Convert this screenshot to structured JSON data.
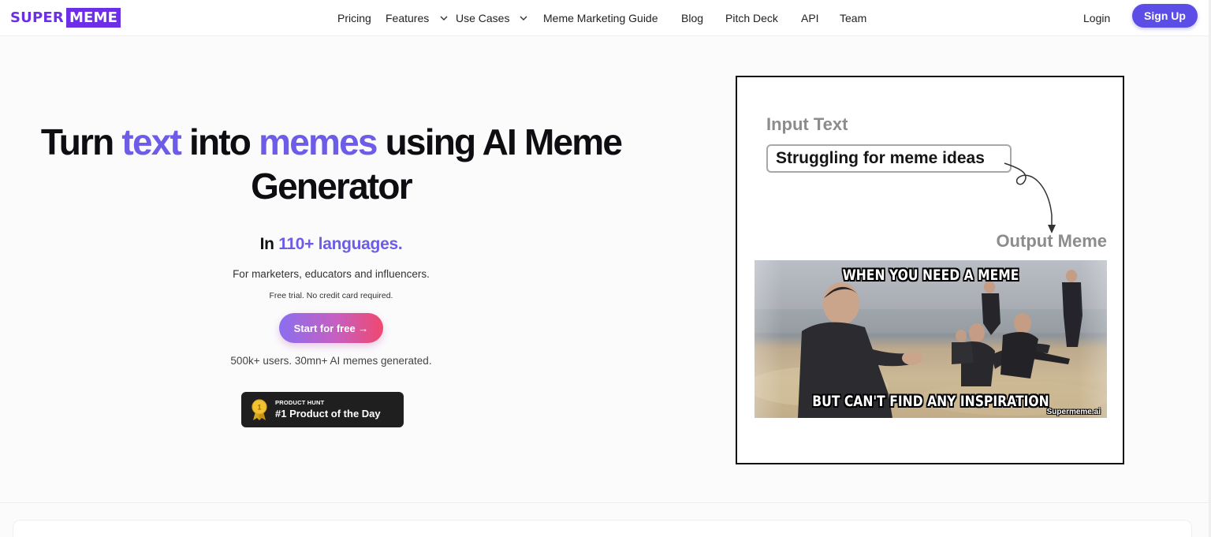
{
  "brand": {
    "word1": "SUPER",
    "word2": "MEME",
    "color": "#6d2ee8"
  },
  "nav": {
    "links": [
      {
        "label": "Pricing",
        "dropdown": false
      },
      {
        "label": "Features",
        "dropdown": true
      },
      {
        "label": "Use Cases",
        "dropdown": true
      },
      {
        "label": "Meme Marketing Guide",
        "dropdown": false
      },
      {
        "label": "Blog",
        "dropdown": false
      },
      {
        "label": "Pitch Deck",
        "dropdown": false
      },
      {
        "label": "API",
        "dropdown": false
      },
      {
        "label": "Team",
        "dropdown": false
      }
    ],
    "login": "Login",
    "signup": "Sign Up",
    "signup_color": "#5b4de6"
  },
  "hero": {
    "headline": {
      "part1": "Turn ",
      "accent1": "text",
      "part2": " into ",
      "accent2": "memes",
      "part3": " using AI Meme Generator",
      "accent_color": "#6c5ce7"
    },
    "languages": {
      "prefix": "In ",
      "accent": "110+ languages."
    },
    "audience": "For marketers, educators and influencers.",
    "trial_note": "Free trial. No credit card required.",
    "cta": "Start for free →",
    "stats": "500k+ users. 30mn+ AI memes generated.",
    "product_hunt": {
      "small": "PRODUCT HUNT",
      "big": "#1 Product of the Day",
      "medal_number": "1"
    }
  },
  "demo": {
    "input_label": "Input Text",
    "input_value": "Struggling for meme ideas",
    "output_label": "Output Meme",
    "meme": {
      "top_caption": "WHEN YOU NEED A MEME",
      "bottom_caption": "BUT CAN'T FIND ANY INSPIRATION",
      "watermark": "Supermeme.ai"
    }
  }
}
